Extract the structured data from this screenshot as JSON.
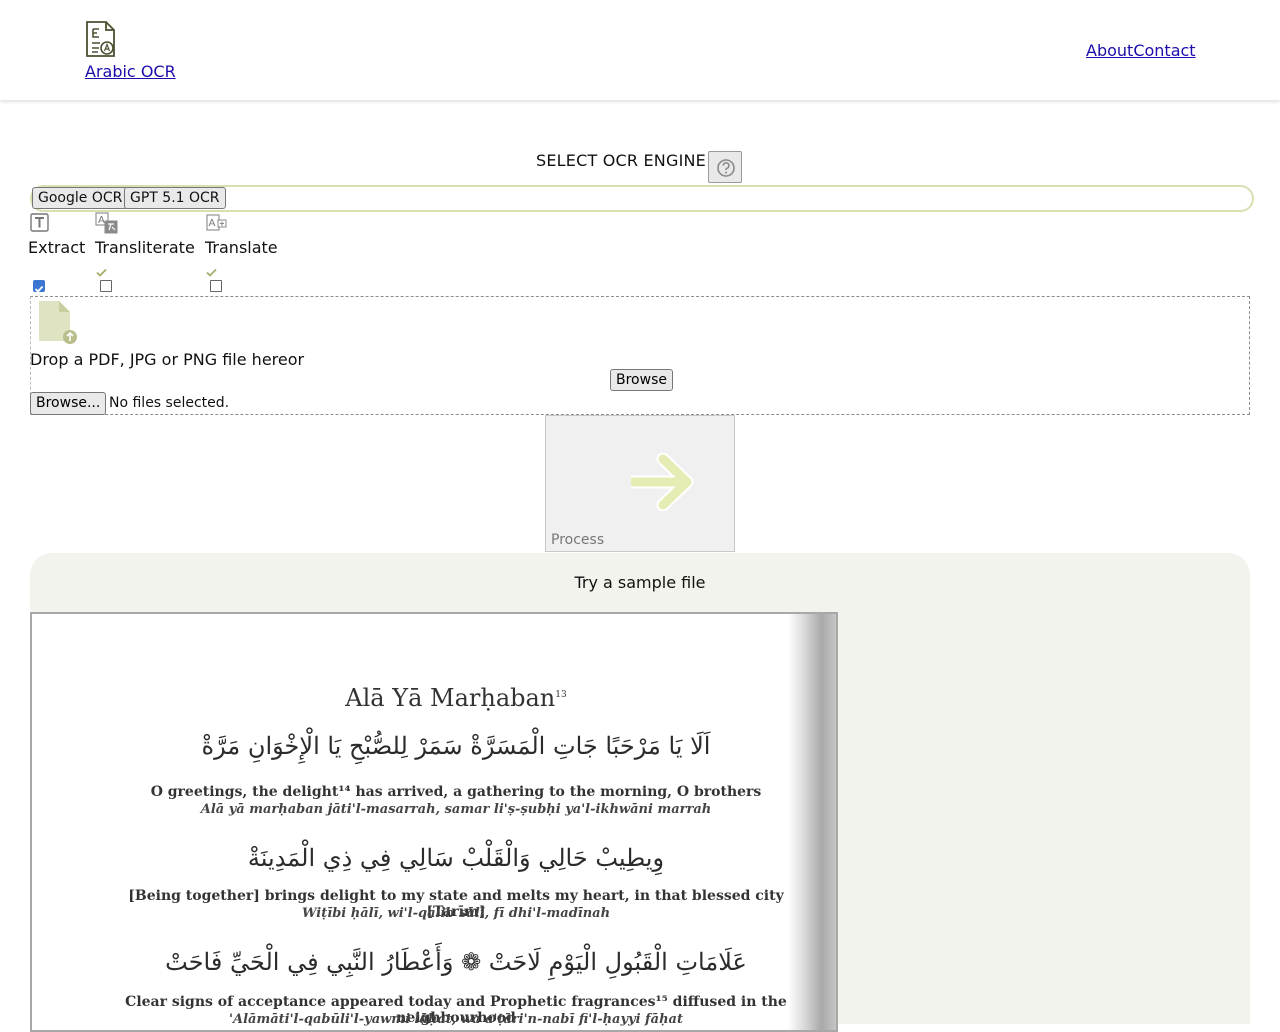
{
  "header": {
    "brand": "Arabic OCR",
    "nav": [
      {
        "label": "About"
      },
      {
        "label": "Contact"
      }
    ]
  },
  "engine": {
    "title": "SELECT OCR ENGINE",
    "options": [
      {
        "label": "Google OCR"
      },
      {
        "label": "GPT 5.1 OCR"
      }
    ]
  },
  "modes": [
    {
      "label": "Extract",
      "icon": "text-icon",
      "checked": true
    },
    {
      "label": "Transliterate",
      "icon": "transliterate-icon",
      "checked": false
    },
    {
      "label": "Translate",
      "icon": "translate-icon",
      "checked": false
    }
  ],
  "upload": {
    "drop_text": "Drop a PDF, JPG or PNG file hereor",
    "browse_label": "Browse",
    "file_input_label": "Browse...",
    "no_files": "No files selected."
  },
  "process": {
    "label": "Process"
  },
  "sample": {
    "title": "Try a sample file",
    "page": {
      "title": "Alā Yā Marḥaban",
      "title_note": "13",
      "lines": [
        {
          "ar": "اَلَا يَا مَرْحَبًا جَاتِ الْمَسَرَّةْ سَمَرْ لِلصُّبْحِ يَا الْإِخْوَانِ مَرَّةْ",
          "en": "O greetings, the delight¹⁴ has arrived, a gathering to the morning, O brothers",
          "tr": "Alā yā marḥaban jāti'l-masarrah, samar li'ṣ-ṣubḥi ya'l-ikhwāni marrah"
        },
        {
          "ar": "وِيطِيبْ حَالِي وَالْقَلْبْ سَالِي فِي ذِي الْمَدِينَةْ",
          "en": "[Being together] brings delight to my state and melts my heart, in that blessed city [Tarīm]",
          "tr": "Wiṭībi ḥālī, wi'l-qalib sālī, fī dhi'l-madīnah"
        },
        {
          "ar": "عَلَامَاتِ الْقَبُولِ الْيَوْمِ لَاحَتْ ❁ وَأَعْطَارُ النَّبِي فِي الْحَيِّ فَاحَتْ",
          "en": "Clear signs of acceptance appeared today and Prophetic fragrances¹⁵ diffused in the neighbourhood",
          "tr": "'Alāmāti'l-qabūli'l-yawmi lāḥat, wa a'ṭāri'n-nabī fi'l-ḥayyi fāḥat"
        }
      ]
    }
  },
  "colors": {
    "link": "#1a0dab",
    "engine_border": "#d9dfb0",
    "checkbox": "#3b76d3",
    "icon_green": "#a8ad6b",
    "panel_bg": "#f3f3ed"
  }
}
